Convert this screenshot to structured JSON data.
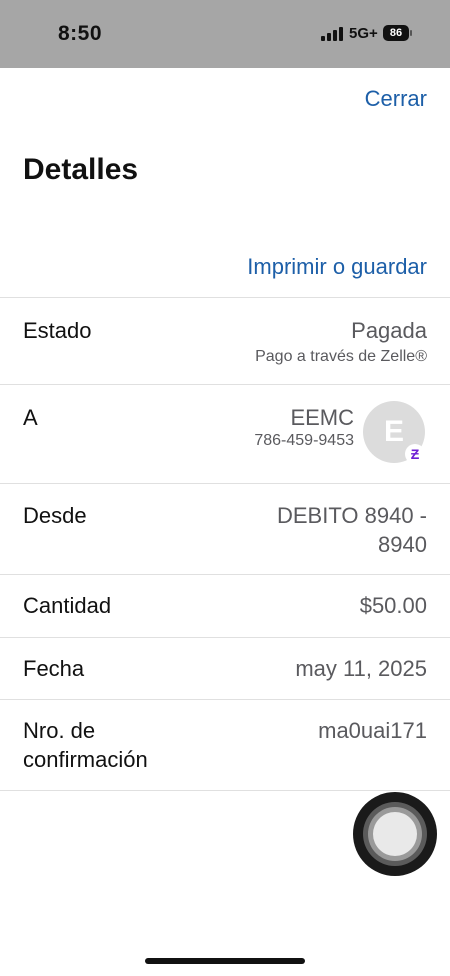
{
  "status_bar": {
    "time": "8:50",
    "network": "5G+",
    "battery": "86"
  },
  "header": {
    "close_label": "Cerrar",
    "title": "Detalles",
    "print_label": "Imprimir o guardar"
  },
  "details": {
    "estado": {
      "label": "Estado",
      "value": "Pagada",
      "subvalue": "Pago a través de Zelle®"
    },
    "a": {
      "label": "A",
      "name": "EEMC",
      "phone": "786-459-9453",
      "avatar_initial": "E",
      "badge": "Ƶ"
    },
    "desde": {
      "label": "Desde",
      "value_line1": "DEBITO 8940 -",
      "value_line2": "8940"
    },
    "cantidad": {
      "label": "Cantidad",
      "value": "$50.00"
    },
    "fecha": {
      "label": "Fecha",
      "value": "may 11, 2025"
    },
    "confirmacion": {
      "label_line1": "Nro. de",
      "label_line2": "confirmación",
      "value": "ma0uai171"
    }
  },
  "colors": {
    "link": "#1d5fa8",
    "status_bar": "#a6a6a6",
    "zelle_purple": "#6d1ed4"
  }
}
